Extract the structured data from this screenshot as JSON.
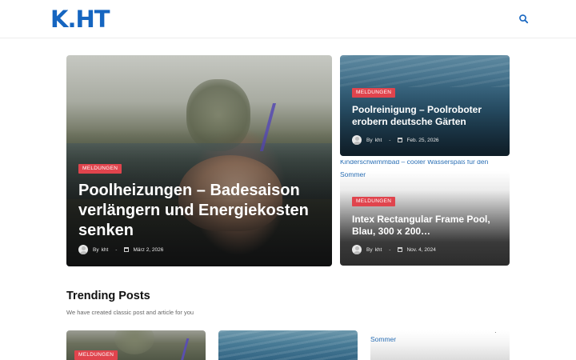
{
  "header": {
    "logo": "K.HT",
    "search_icon": "search-icon"
  },
  "colors": {
    "brand": "#1565c0",
    "badge": "#e0444d",
    "link": "#2a6fb5"
  },
  "featured": [
    {
      "category": "MELDUNGEN",
      "title": "Poolheizungen – Badesaison verlängern und Energiekosten senken",
      "by": "By",
      "author": "kht",
      "date": "März 2, 2026"
    },
    {
      "category": "MELDUNGEN",
      "title": "Poolreinigung – Poolroboter erobern deutsche Gärten",
      "by": "By",
      "author": "kht",
      "date": "Feb. 25, 2026"
    },
    {
      "category": "MELDUNGEN",
      "title": "Intex Rectangular Frame Pool, Blau, 300 x 200…",
      "by": "By",
      "author": "kht",
      "date": "Nov. 4, 2024",
      "image_alt_line1": "Kinderschwimmbad – cooler Wasserspaß für den",
      "image_alt_line2": "Sommer"
    }
  ],
  "trending": {
    "title": "Trending Posts",
    "subtitle": "We have created classic post and article for you",
    "items": [
      {
        "category": "MELDUNGEN"
      },
      {
        "category": ""
      },
      {
        "image_alt": "Sommer"
      }
    ]
  }
}
